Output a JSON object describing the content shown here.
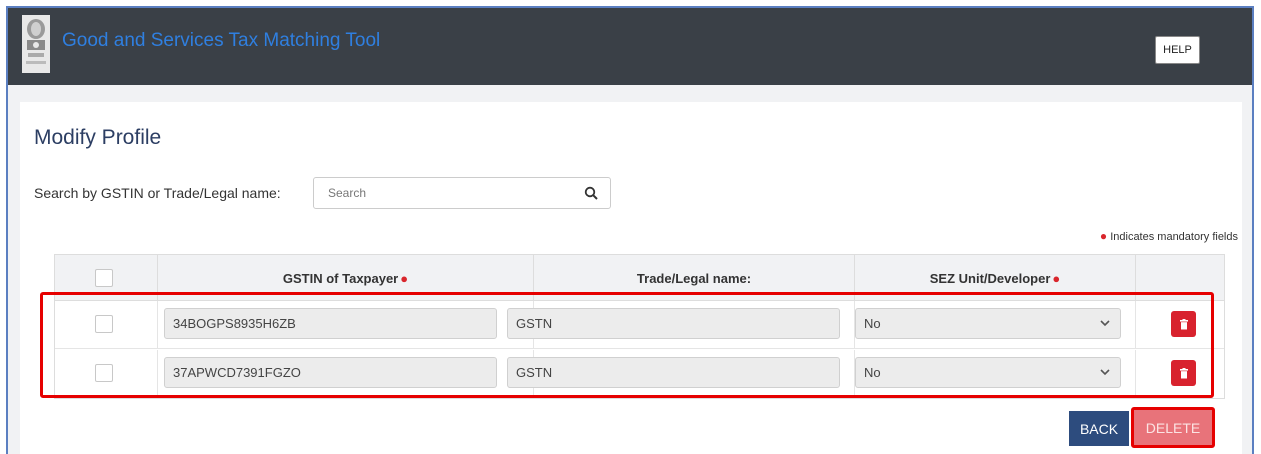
{
  "header": {
    "app_title": "Good and Services Tax Matching Tool",
    "help_label": "HELP"
  },
  "page": {
    "title": "Modify Profile",
    "search_label": "Search by GSTIN or Trade/Legal name:",
    "search_placeholder": "Search",
    "mandatory_note": "Indicates mandatory fields"
  },
  "table": {
    "columns": [
      "",
      "GSTIN of Taxpayer",
      "Trade/Legal name:",
      "SEZ Unit/Developer",
      ""
    ],
    "rows": [
      {
        "gstin": "34BOGPS8935H6ZB",
        "trade_name": "GSTN",
        "sez": "No"
      },
      {
        "gstin": "37APWCD7391FGZO",
        "trade_name": "GSTN",
        "sez": "No"
      }
    ]
  },
  "actions": {
    "back_label": "BACK",
    "delete_label": "DELETE"
  },
  "colors": {
    "header_bg": "#3a4047",
    "title_blue": "#2f7fe0",
    "back_button": "#2d4c7e",
    "delete_button": "#e8737a",
    "highlight": "#e60000"
  }
}
